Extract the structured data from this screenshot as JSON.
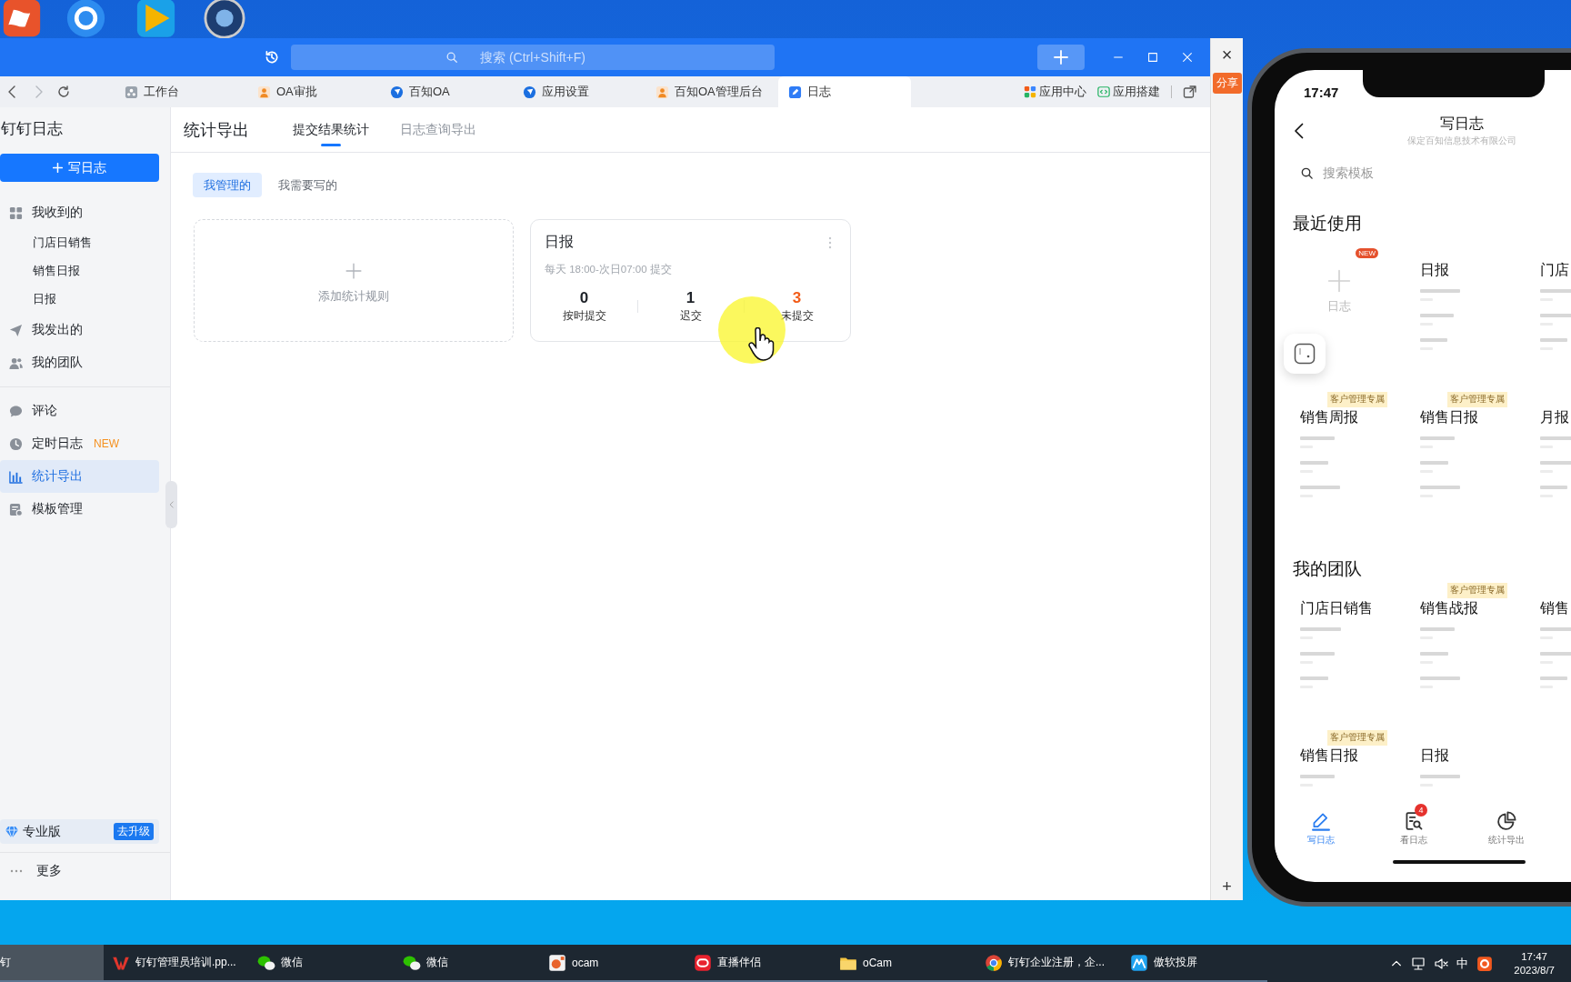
{
  "search": {
    "placeholder": "搜索 (Ctrl+Shift+F)"
  },
  "tabs": [
    {
      "label": "工作台",
      "kind": "workbench",
      "selected": false
    },
    {
      "label": "OA审批",
      "kind": "person",
      "selected": false
    },
    {
      "label": "百知OA",
      "kind": "compass",
      "selected": false
    },
    {
      "label": "应用设置",
      "kind": "compass",
      "selected": false
    },
    {
      "label": "百知OA管理后台",
      "kind": "person",
      "selected": false
    },
    {
      "label": "日志",
      "kind": "note",
      "selected": true
    }
  ],
  "toolbar_links": [
    {
      "label": "应用中心",
      "kind": "grid"
    },
    {
      "label": "应用搭建",
      "kind": "code"
    }
  ],
  "sidebar": {
    "title": "钉钉日志",
    "write_button": "写日志",
    "groups": [
      {
        "items": [
          {
            "label": "我收到的",
            "kind": "grid",
            "selected": false,
            "children": [
              {
                "label": "门店日销售",
                "selected": false
              },
              {
                "label": "销售日报",
                "selected": false
              },
              {
                "label": "日报",
                "selected": false
              }
            ]
          },
          {
            "label": "我发出的",
            "kind": "send",
            "selected": false
          },
          {
            "label": "我的团队",
            "kind": "team",
            "selected": false
          }
        ]
      },
      {
        "items": [
          {
            "label": "评论",
            "kind": "comment",
            "selected": false
          },
          {
            "label": "定时日志",
            "kind": "clock",
            "badge": "NEW",
            "selected": false
          },
          {
            "label": "统计导出",
            "kind": "chart",
            "selected": true
          },
          {
            "label": "模板管理",
            "kind": "template",
            "selected": false
          }
        ]
      }
    ],
    "plan": {
      "label": "专业版",
      "action": "去升级"
    },
    "more": "更多"
  },
  "main": {
    "title": "统计导出",
    "tabs": [
      {
        "label": "提交结果统计",
        "selected": true
      },
      {
        "label": "日志查询导出",
        "selected": false
      }
    ],
    "filters": [
      {
        "label": "我管理的",
        "selected": true
      },
      {
        "label": "我需要写的",
        "selected": false
      }
    ],
    "add_rule": "添加统计规则",
    "rules": [
      {
        "title": "日报",
        "schedule": "每天 18:00-次日07:00 提交",
        "stats": [
          {
            "value": "0",
            "label": "按时提交",
            "kind": "normal"
          },
          {
            "value": "1",
            "label": "迟交",
            "kind": "normal"
          },
          {
            "value": "3",
            "label": "未提交",
            "kind": "alert"
          }
        ]
      }
    ]
  },
  "background_window": {
    "close": "×",
    "share": "分享",
    "add": "+"
  },
  "phone": {
    "time": "17:47",
    "title": "写日志",
    "subtitle": "保定百知信息技术有限公司",
    "search_placeholder": "搜索模板",
    "sections": [
      {
        "title": "最近使用",
        "templates": [
          {
            "kind": "new",
            "label": "日志",
            "badge": "NEW"
          },
          {
            "kind": "template",
            "title": "日报"
          },
          {
            "kind": "template",
            "title": "门店"
          },
          {
            "kind": "template",
            "title": "销售周报",
            "tag": "客户管理专属"
          },
          {
            "kind": "template",
            "title": "销售日报",
            "tag": "客户管理专属"
          },
          {
            "kind": "template",
            "title": "月报"
          }
        ]
      },
      {
        "title": "我的团队",
        "templates": [
          {
            "kind": "template",
            "title": "门店日销售"
          },
          {
            "kind": "template",
            "title": "销售战报",
            "tag": "客户管理专属"
          },
          {
            "kind": "template",
            "title": "销售"
          },
          {
            "kind": "template",
            "title": "销售日报",
            "tag": "客户管理专属"
          },
          {
            "kind": "template",
            "title": "日报"
          }
        ]
      }
    ],
    "nav": [
      {
        "label": "写日志",
        "kind": "pen",
        "selected": true
      },
      {
        "label": "看日志",
        "kind": "doc-search",
        "badge": "4",
        "selected": false
      },
      {
        "label": "统计导出",
        "kind": "pie",
        "selected": false
      }
    ]
  },
  "taskbar": {
    "items": [
      {
        "label": "钉",
        "kind": "none",
        "selected": true
      },
      {
        "label": "钉钉管理员培训.pp...",
        "kind": "wps",
        "selected": false
      },
      {
        "label": "微信",
        "kind": "wechat",
        "selected": false
      },
      {
        "label": "微信",
        "kind": "wechat",
        "selected": false
      },
      {
        "label": "ocam",
        "kind": "ocam",
        "selected": false
      },
      {
        "label": "直播伴侣",
        "kind": "live",
        "selected": false
      },
      {
        "label": "oCam",
        "kind": "folder",
        "selected": false
      },
      {
        "label": "钉钉企业注册，企...",
        "kind": "chrome",
        "selected": false
      },
      {
        "label": "傲软投屏",
        "kind": "mirror",
        "selected": false
      }
    ],
    "ime": "中",
    "time": "17:47",
    "date": "2023/8/7"
  }
}
